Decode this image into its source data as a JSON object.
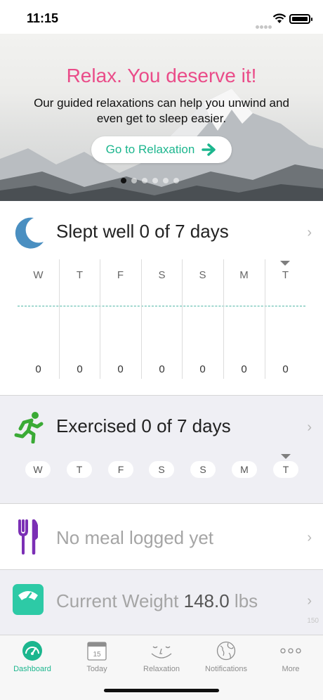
{
  "status_bar": {
    "time": "11:15"
  },
  "hero": {
    "title": "Relax. You deserve it!",
    "subtitle": "Our guided relaxations can help you unwind and even get to sleep easier.",
    "button_label": "Go to Relaxation",
    "page_count": 6,
    "active_page": 0
  },
  "sleep": {
    "title": "Slept well 0 of 7 days",
    "days": [
      "W",
      "T",
      "F",
      "S",
      "S",
      "M",
      "T"
    ],
    "values": [
      "0",
      "0",
      "0",
      "0",
      "0",
      "0",
      "0"
    ],
    "today_index": 6
  },
  "exercise": {
    "title": "Exercised 0 of 7 days",
    "days": [
      "W",
      "T",
      "F",
      "S",
      "S",
      "M",
      "T"
    ],
    "today_index": 6
  },
  "meal": {
    "title": "No meal logged yet"
  },
  "weight": {
    "label": "Current Weight",
    "value": "148.0",
    "unit": "lbs",
    "corner_note": "150"
  },
  "tabbar": {
    "tabs": [
      {
        "label": "Dashboard",
        "icon": "gauge-icon",
        "active": true
      },
      {
        "label": "Today",
        "icon": "calendar-icon",
        "day": "15"
      },
      {
        "label": "Relaxation",
        "icon": "smile-face-icon"
      },
      {
        "label": "Notifications",
        "icon": "globe-icon"
      },
      {
        "label": "More",
        "icon": "more-dots-icon"
      }
    ]
  },
  "colors": {
    "accent": "#1cb68e",
    "hero_title": "#ea4c89",
    "moon": "#4a8fc1",
    "runner": "#3aaa35",
    "fork": "#7b2fb5",
    "scale": "#2dcaa6"
  }
}
